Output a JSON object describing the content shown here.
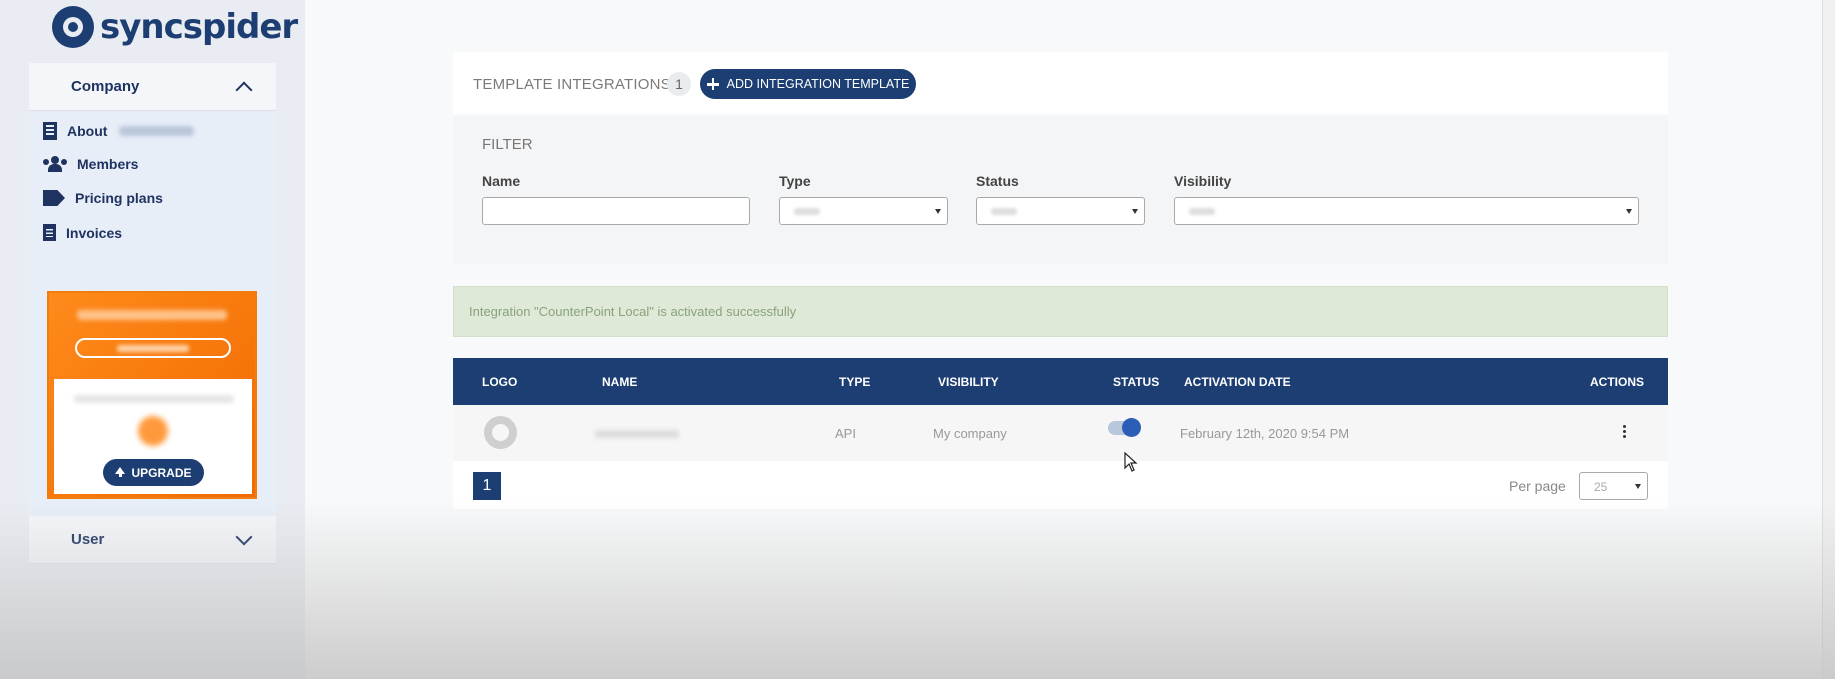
{
  "brand": {
    "name": "syncspider"
  },
  "sidebar": {
    "company_label": "Company",
    "items": [
      {
        "label": "About",
        "icon": "building-icon"
      },
      {
        "label": "Members",
        "icon": "users-icon"
      },
      {
        "label": "Pricing plans",
        "icon": "tags-icon"
      },
      {
        "label": "Invoices",
        "icon": "file-icon"
      }
    ],
    "upgrade_label": "UPGRADE",
    "user_label": "User"
  },
  "main": {
    "title": "TEMPLATE INTEGRATIONS",
    "count": "1",
    "add_button": "ADD INTEGRATION TEMPLATE",
    "filter": {
      "title": "FILTER",
      "name_label": "Name",
      "type_label": "Type",
      "status_label": "Status",
      "visibility_label": "Visibility"
    },
    "alert": "Integration \"CounterPoint Local\" is activated successfully",
    "table": {
      "columns": [
        "LOGO",
        "NAME",
        "TYPE",
        "VISIBILITY",
        "STATUS",
        "ACTIVATION DATE",
        "ACTIONS"
      ],
      "rows": [
        {
          "type": "API",
          "visibility": "My company",
          "status_on": true,
          "activation_date": "February 12th, 2020 9:54 PM"
        }
      ]
    },
    "pagination": {
      "current_page": "1",
      "per_page_label": "Per page",
      "per_page_value": "25"
    }
  },
  "colors": {
    "brand": "#1d3e72",
    "promo": "#f27d0c",
    "alert_bg": "#dfe9d8"
  }
}
